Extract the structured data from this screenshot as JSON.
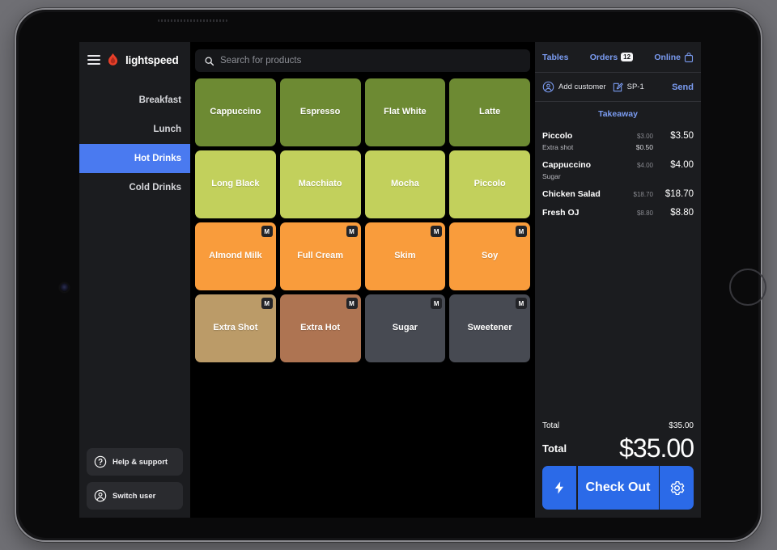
{
  "sidebar": {
    "brand": "lightspeed",
    "menu_icon": "hamburger-icon",
    "categories": [
      {
        "label": "Breakfast",
        "active": false
      },
      {
        "label": "Lunch",
        "active": false
      },
      {
        "label": "Hot Drinks",
        "active": true
      },
      {
        "label": "Cold Drinks",
        "active": false
      }
    ],
    "footer_buttons": [
      {
        "label": "Help & support",
        "icon": "question-circle-icon"
      },
      {
        "label": "Switch user",
        "icon": "user-circle-icon"
      }
    ]
  },
  "search": {
    "icon": "search-icon",
    "placeholder": "Search for products",
    "value": ""
  },
  "products": [
    {
      "label": "Cappuccino",
      "color": "#6d8a33",
      "badge": ""
    },
    {
      "label": "Espresso",
      "color": "#6d8a33",
      "badge": ""
    },
    {
      "label": "Flat White",
      "color": "#6d8a33",
      "badge": ""
    },
    {
      "label": "Latte",
      "color": "#6d8a33",
      "badge": ""
    },
    {
      "label": "Long Black",
      "color": "#c2d05c",
      "badge": ""
    },
    {
      "label": "Macchiato",
      "color": "#c2d05c",
      "badge": ""
    },
    {
      "label": "Mocha",
      "color": "#c2d05c",
      "badge": ""
    },
    {
      "label": "Piccolo",
      "color": "#c2d05c",
      "badge": ""
    },
    {
      "label": "Almond Milk",
      "color": "#f99c3c",
      "badge": "M"
    },
    {
      "label": "Full Cream",
      "color": "#f99c3c",
      "badge": "M"
    },
    {
      "label": "Skim",
      "color": "#f99c3c",
      "badge": "M"
    },
    {
      "label": "Soy",
      "color": "#f99c3c",
      "badge": "M"
    },
    {
      "label": "Extra Shot",
      "color": "#bb9b68",
      "badge": "M"
    },
    {
      "label": "Extra Hot",
      "color": "#ae7452",
      "badge": "M"
    },
    {
      "label": "Sugar",
      "color": "#474a52",
      "badge": "M"
    },
    {
      "label": "Sweetener",
      "color": "#474a52",
      "badge": "M"
    }
  ],
  "order": {
    "tabs": [
      {
        "label": "Tables",
        "badge": "",
        "icon": ""
      },
      {
        "label": "Orders",
        "badge": "12",
        "icon": ""
      },
      {
        "label": "Online",
        "badge": "",
        "icon": "shopping-bag-icon"
      }
    ],
    "actions": {
      "add_customer_label": "Add customer",
      "add_customer_icon": "user-circle-icon",
      "reference_label": "SP-1",
      "reference_icon": "edit-note-icon",
      "send_label": "Send"
    },
    "order_type": "Takeaway",
    "items": [
      {
        "name": "Piccolo",
        "unit_price": "$3.00",
        "total": "$3.50",
        "modifiers": [
          {
            "name": "Extra shot",
            "price": "$0.50"
          }
        ]
      },
      {
        "name": "Cappuccino",
        "unit_price": "$4.00",
        "total": "$4.00",
        "modifiers": [
          {
            "name": "Sugar",
            "price": ""
          }
        ]
      },
      {
        "name": "Chicken Salad",
        "unit_price": "$18.70",
        "total": "$18.70",
        "modifiers": []
      },
      {
        "name": "Fresh OJ",
        "unit_price": "$8.80",
        "total": "$8.80",
        "modifiers": []
      }
    ],
    "totals": {
      "subtotal_label": "Total",
      "subtotal_value": "$35.00",
      "grand_label": "Total",
      "grand_value": "$35.00"
    },
    "checkout": {
      "quick_pay_icon": "lightning-bolt-icon",
      "label": "Check Out",
      "settings_icon": "gear-icon"
    }
  },
  "colors": {
    "accent_blue": "#2b6ae8",
    "link_blue": "#7b9cf2",
    "sidebar_bg": "#1b1c1f",
    "screen_bg": "#000000",
    "brand_red": "#e8402a"
  }
}
